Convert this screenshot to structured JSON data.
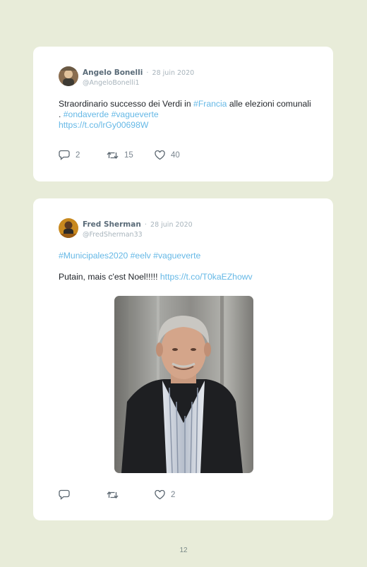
{
  "tweets": [
    {
      "author": "Angelo Bonelli",
      "date": "28 juin 2020",
      "handle": "@AngeloBonelli1",
      "text_parts": [
        "Straordinario successo dei Verdi in ",
        "#Francia",
        " alle elezioni comunali . ",
        "#ondaverde",
        " ",
        "#vagueverte",
        " ",
        "https://t.co/lrGy00698W"
      ],
      "replies": "2",
      "retweets": "15",
      "likes": "40"
    },
    {
      "author": "Fred Sherman",
      "date": "28 juin 2020",
      "handle": "@FredSherman33",
      "hashtags_line": [
        "#Municipales2020",
        " ",
        "#eelv",
        " ",
        "#vagueverte"
      ],
      "text": "Putain, mais c'est Noel!!!!! ",
      "link": "https://t.co/T0kaEZhowv",
      "likes": "2"
    }
  ],
  "separator": "·",
  "page_number": "12",
  "colors": {
    "background": "#e8ecd9",
    "link": "#65b8e6",
    "card": "#ffffff"
  },
  "icons": [
    "reply-icon",
    "retweet-icon",
    "heart-icon"
  ]
}
